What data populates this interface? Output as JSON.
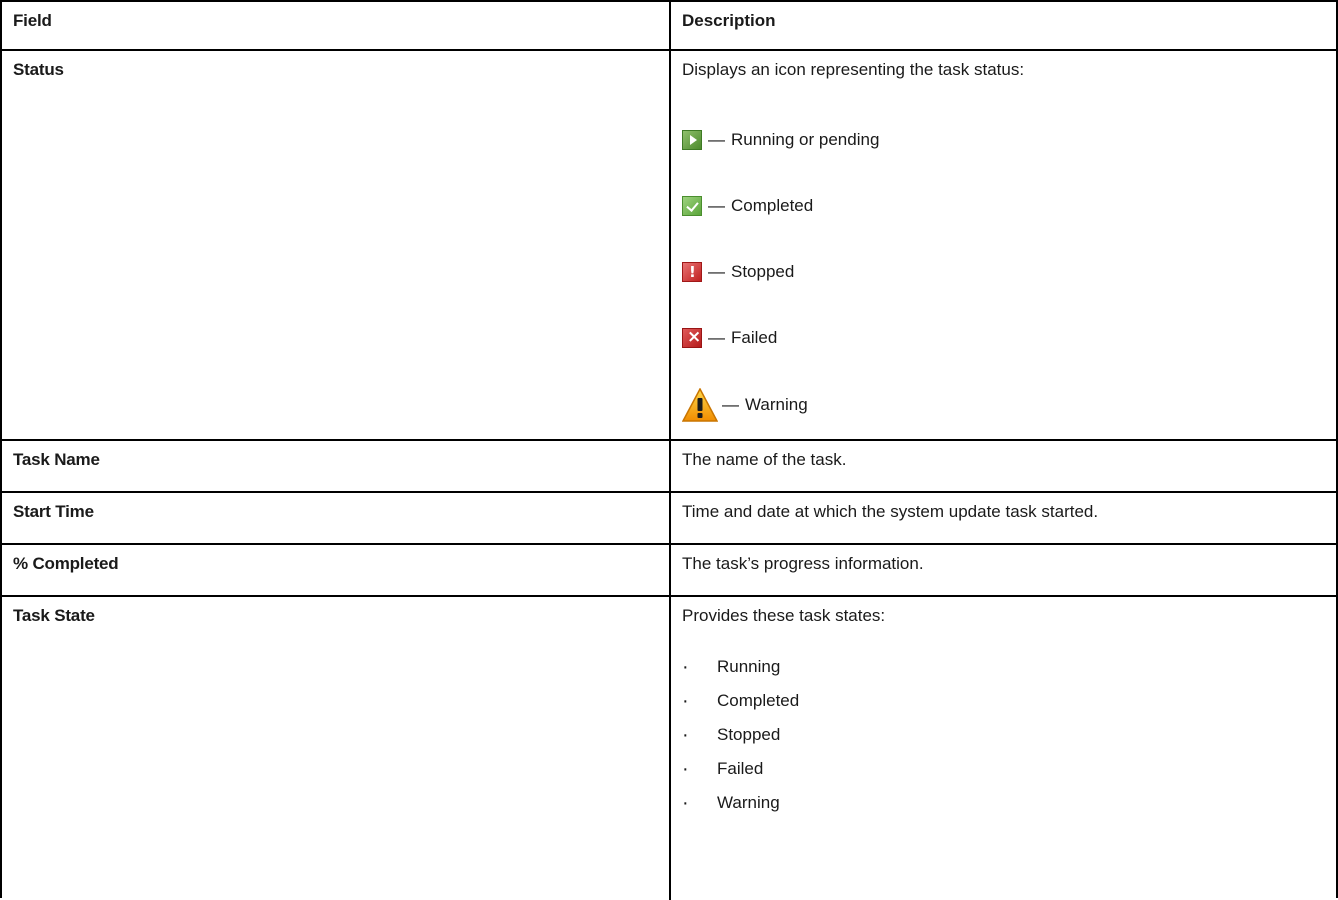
{
  "header": {
    "field": "Field",
    "description": "Description"
  },
  "rows": {
    "status": {
      "field": "Status",
      "description": "Displays an icon representing the task status:",
      "items": [
        {
          "icon": "running-icon",
          "dash": "—",
          "label": "Running or pending"
        },
        {
          "icon": "completed-icon",
          "dash": "—",
          "label": "Completed"
        },
        {
          "icon": "stopped-icon",
          "dash": "—",
          "label": "Stopped"
        },
        {
          "icon": "failed-icon",
          "dash": "—",
          "label": "Failed"
        },
        {
          "icon": "warning-icon",
          "dash": "—",
          "label": "Warning"
        }
      ]
    },
    "task_name": {
      "field": "Task Name",
      "description": "The name of the task."
    },
    "start_time": {
      "field": "Start Time",
      "description": "Time and date at which the system update task started."
    },
    "percent_completed": {
      "field": "% Completed",
      "description": "The task’s progress information."
    },
    "task_state": {
      "field": "Task State",
      "description": "Provides these task states:",
      "states": [
        "Running",
        "Completed",
        "Stopped",
        "Failed",
        "Warning"
      ]
    }
  },
  "colors": {
    "running": "#4d8a2e",
    "completed": "#5aa53a",
    "stopped": "#c02020",
    "failed": "#b51c1c",
    "warning": "#f5a623"
  }
}
